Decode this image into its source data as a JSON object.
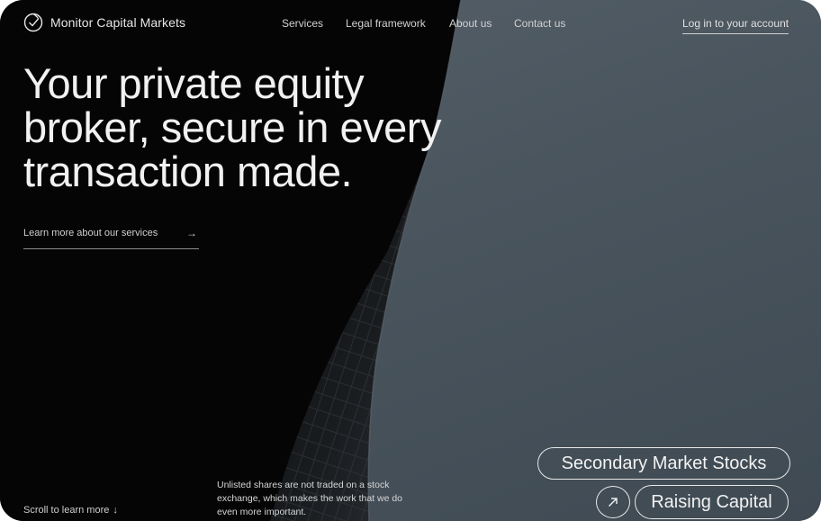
{
  "brand": {
    "name": "Monitor Capital Markets",
    "logo_icon": "check-circle-logo"
  },
  "nav": {
    "links": [
      {
        "label": "Services"
      },
      {
        "label": "Legal framework"
      },
      {
        "label": "About us"
      },
      {
        "label": "Contact us"
      }
    ],
    "login_label": "Log in to your account"
  },
  "hero": {
    "lines": [
      "Your private equity",
      "broker, secure in every",
      "transaction made."
    ]
  },
  "cta": {
    "label": "Learn more about our services",
    "arrow": "→"
  },
  "footer": {
    "scroll_label": "Scroll to learn more",
    "scroll_arrow": "↓",
    "note": "Unlisted shares are not traded on a stock exchange, which makes the work that we do even more important."
  },
  "tags": {
    "secondary": "Secondary Market Stocks",
    "raising": "Raising Capital",
    "arrow_icon": "arrow-up-right-icon"
  },
  "colors": {
    "sky": "#4a555e",
    "building_dark": "#050505",
    "text": "#f1f1f1"
  }
}
